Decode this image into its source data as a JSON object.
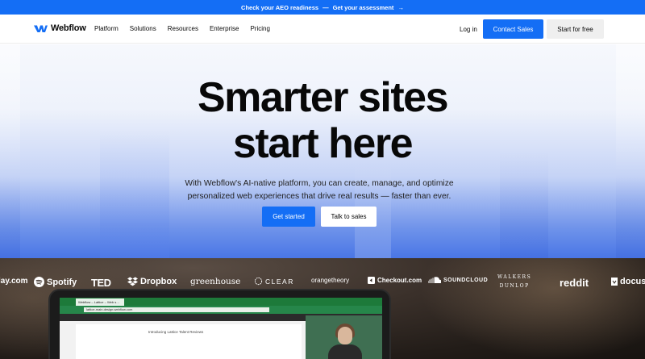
{
  "announcement": {
    "left": "Check your AEO readiness",
    "separator": "—",
    "right": "Get your assessment",
    "arrow": "→"
  },
  "nav": {
    "brand": "Webflow",
    "menu": [
      "Platform",
      "Solutions",
      "Resources",
      "Enterprise",
      "Pricing"
    ],
    "login": "Log in",
    "contact_sales": "Contact Sales",
    "start_free": "Start for free"
  },
  "hero": {
    "headline_line1": "Smarter sites",
    "headline_line2": "start here",
    "subtitle_line1": "With Webflow's AI-native platform, you can create, manage, and optimize",
    "subtitle_line2": "personalized web experiences that drive real results — faster than ever.",
    "primary_button": "Get started",
    "secondary_button": "Talk to sales"
  },
  "customer_logos": {
    "play": "lay.com",
    "spotify": "Spotify",
    "ted": "TED",
    "dropbox": "Dropbox",
    "greenhouse": "greenhouse",
    "clear": "CLEAR",
    "orangetheory": "orangetheory",
    "checkout": "Checkout.com",
    "soundcloud": "SOUNDCLOUD",
    "walkers_1": "WALKERS",
    "walkers_2": "DUNLOP",
    "reddit": "reddit",
    "docusign": "docus"
  },
  "laptop_screen": {
    "tab_title": "Webflow – Lattice – Web s…",
    "url": "lattice-main.design.webflow.com",
    "intro_text": "Introducing Lattice Talent Reviews"
  },
  "colors": {
    "brand_blue": "#146ef5",
    "text_dark": "#080808"
  }
}
